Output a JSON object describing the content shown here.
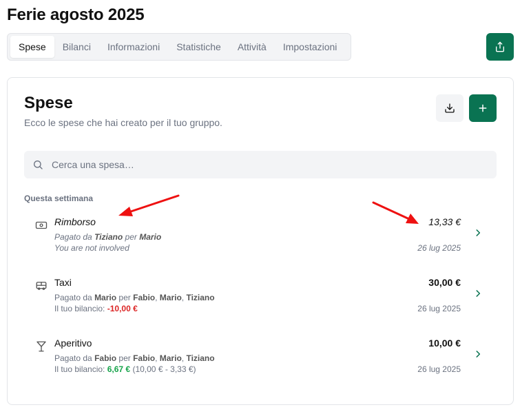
{
  "page": {
    "title": "Ferie agosto 2025"
  },
  "tabs": [
    {
      "label": "Spese",
      "active": true
    },
    {
      "label": "Bilanci",
      "active": false
    },
    {
      "label": "Informazioni",
      "active": false
    },
    {
      "label": "Statistiche",
      "active": false
    },
    {
      "label": "Attività",
      "active": false
    },
    {
      "label": "Impostazioni",
      "active": false
    }
  ],
  "header": {
    "share_icon": "share-icon"
  },
  "card": {
    "title": "Spese",
    "subtitle": "Ecco le spese che hai creato per il tuo gruppo.",
    "export_icon": "download-icon",
    "add_icon": "plus-icon"
  },
  "search": {
    "placeholder": "Cerca una spesa…",
    "value": ""
  },
  "section": {
    "label": "Questa settimana"
  },
  "expenses": [
    {
      "icon": "banknote-icon",
      "title": "Rimborso",
      "amount": "13,33 €",
      "paid_prefix": "Pagato da",
      "payer": "Tiziano",
      "for_word": "per",
      "participants": [
        "Mario"
      ],
      "status": "You are not involved",
      "date": "26 lug 2025",
      "italic": true
    },
    {
      "icon": "bus-icon",
      "title": "Taxi",
      "amount": "30,00 €",
      "paid_prefix": "Pagato da",
      "payer": "Mario",
      "for_word": "per",
      "participants": [
        "Fabio",
        "Mario",
        "Tiziano"
      ],
      "balance_label": "Il tuo bilancio:",
      "balance_value": "-10,00 €",
      "balance_detail": "",
      "date": "26 lug 2025",
      "italic": false
    },
    {
      "icon": "cocktail-icon",
      "title": "Aperitivo",
      "amount": "10,00 €",
      "paid_prefix": "Pagato da",
      "payer": "Fabio",
      "for_word": "per",
      "participants": [
        "Fabio",
        "Mario",
        "Tiziano"
      ],
      "balance_label": "Il tuo bilancio:",
      "balance_value": "6,67 €",
      "balance_detail": "(10,00 € - 3,33 €)",
      "date": "26 lug 2025",
      "italic": false
    }
  ],
  "colors": {
    "accent": "#0a7352",
    "negative": "#dc2626",
    "positive": "#16a34a",
    "annotation_arrow": "#ee1111"
  }
}
